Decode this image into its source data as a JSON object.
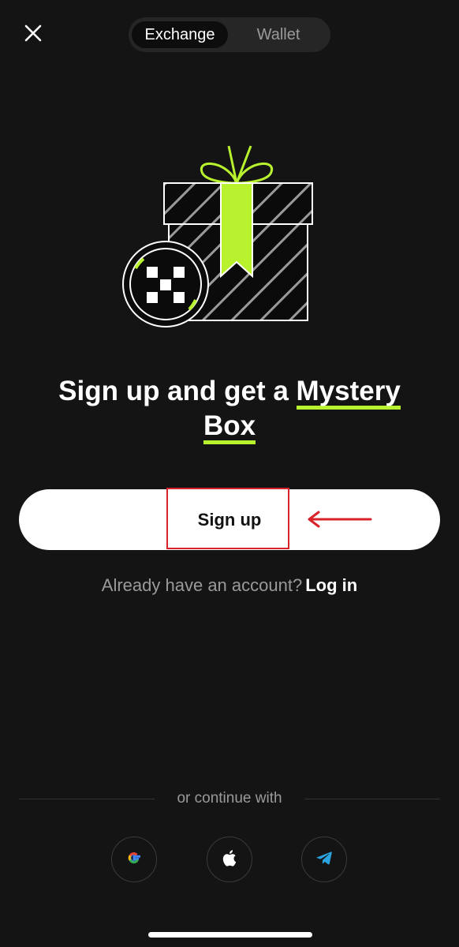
{
  "header": {
    "tabs": [
      {
        "label": "Exchange",
        "selected": true
      },
      {
        "label": "Wallet",
        "selected": false
      }
    ]
  },
  "headline": {
    "prefix": "Sign up and get a ",
    "highlight_1": "Mystery",
    "highlight_2": "Box"
  },
  "primary_action": {
    "label": "Sign up"
  },
  "login_prompt": {
    "text": "Already have an account?",
    "link_label": "Log in"
  },
  "social": {
    "divider_label": "or continue with",
    "providers": [
      {
        "name": "Google",
        "icon": "google-icon"
      },
      {
        "name": "Apple",
        "icon": "apple-icon"
      },
      {
        "name": "Telegram",
        "icon": "telegram-icon"
      }
    ]
  },
  "colors": {
    "background": "#141414",
    "accent": "#b8f12e",
    "annotation": "#d8232a",
    "button_bg": "#ffffff"
  }
}
